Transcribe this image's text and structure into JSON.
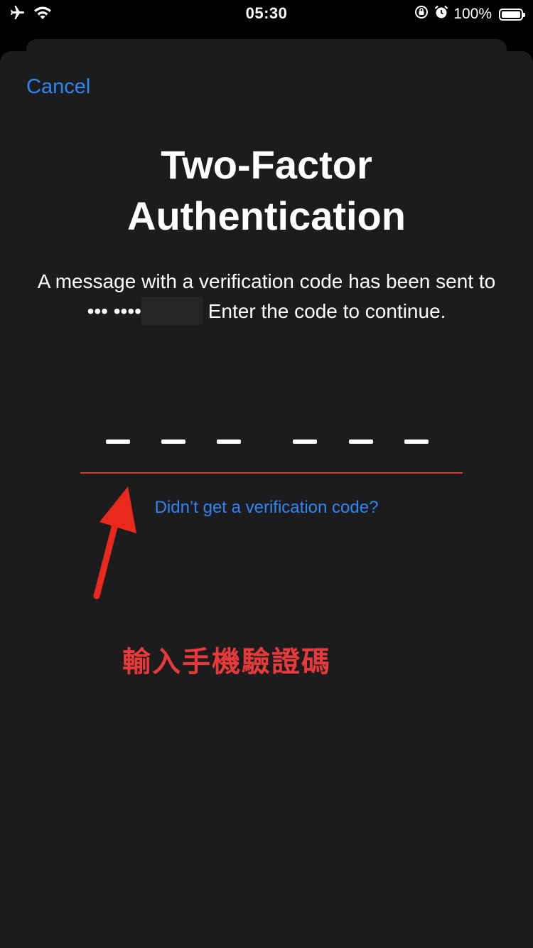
{
  "status_bar": {
    "time": "05:30",
    "battery_percent": "100%",
    "icons": [
      "airplane-mode-icon",
      "wifi-icon",
      "orientation-lock-icon",
      "alarm-icon",
      "battery-icon"
    ]
  },
  "sheet": {
    "cancel_label": "Cancel",
    "title_line1": "Two-Factor",
    "title_line2": "Authentication",
    "message_before": "A message with a verification code has been sent to ••• ••••",
    "message_after": " Enter the code to continue.",
    "code_slot_count": 6,
    "resend_label": "Didn’t get a verification code?"
  },
  "annotation": {
    "text": "輸入手機驗證碼",
    "color": "#e83a3a"
  },
  "colors": {
    "accent": "#2f86f0",
    "sheet_background": "#1c1c1e",
    "underline": "#d43a2a"
  }
}
